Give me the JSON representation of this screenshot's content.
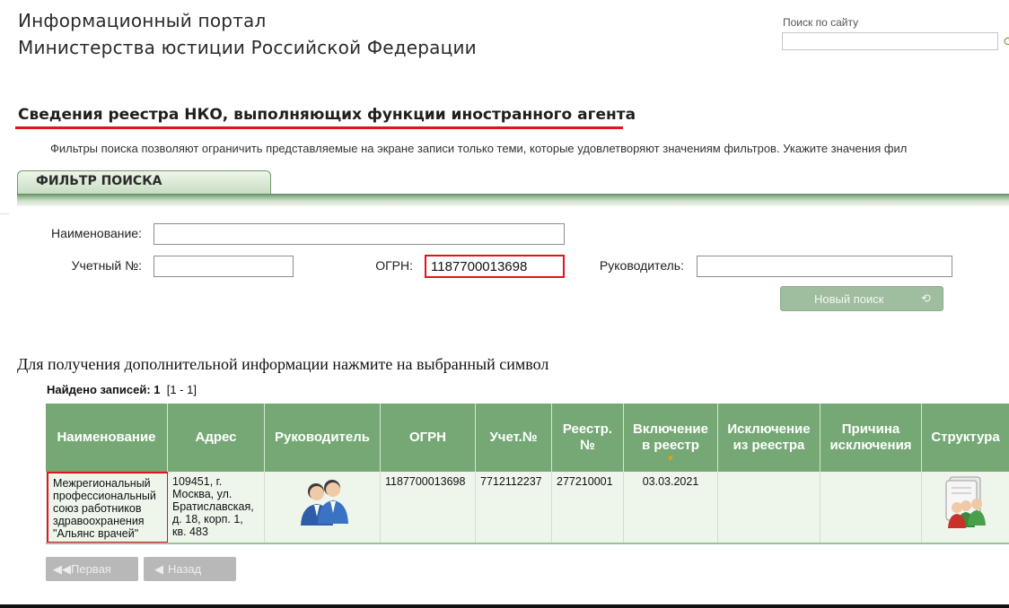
{
  "header": {
    "title_line1": "Информационный портал",
    "title_line2": "Министерства юстиции Российской Федерации",
    "search_label": "Поиск по сайту",
    "search_value": ""
  },
  "page": {
    "heading": "Сведения реестра НКО, выполняющих функции иностранного агента",
    "filter_note": "Фильтры поиска позволяют ограничить представляемые на экране записи только теми, которые удовлетворяют значениям фильтров. Укажите значения фил"
  },
  "filter": {
    "tab_label": "ФИЛЬТР ПОИСКА",
    "name_label": "Наименование:",
    "name_value": "",
    "account_label": "Учетный №:",
    "account_value": "",
    "ogrn_label": "ОГРН:",
    "ogrn_value": "1187700013698",
    "head_label": "Руководитель:",
    "head_value": "",
    "new_search_label": "Новый поиск",
    "new_search_icon": "refresh-icon"
  },
  "results": {
    "info_text": "Для получения дополнительной информации нажмите на выбранный символ",
    "found_label": "Найдено записей: 1",
    "found_range": "[1 - 1]",
    "columns": [
      "Наименование",
      "Адрес",
      "Руководитель",
      "ОГРН",
      "Учет.№",
      "Реестр. №",
      "Включение в реестр",
      "Исключение из реестра",
      "Причина исключения",
      "Структура"
    ],
    "rows": [
      {
        "name": "Межрегиональный профессиональный союз работников здравоохранения \"Альянс врачей\"",
        "address": "109451, г. Москва, ул. Братиславская, д. 18, корп. 1, кв. 483",
        "head_icon": "people-icon",
        "ogrn": "1187700013698",
        "account": "7712112237",
        "registry_no": "277210001",
        "included": "03.03.2021",
        "excluded": "",
        "reason": "",
        "structure_icon": "structure-icon"
      }
    ]
  },
  "pager": {
    "first_label": "Первая",
    "back_label": "Назад"
  },
  "colors": {
    "header_green": "#76a876",
    "row_bg": "#eef6ec",
    "highlight_red": "#e0141c",
    "button_green": "#9fbd9f"
  }
}
